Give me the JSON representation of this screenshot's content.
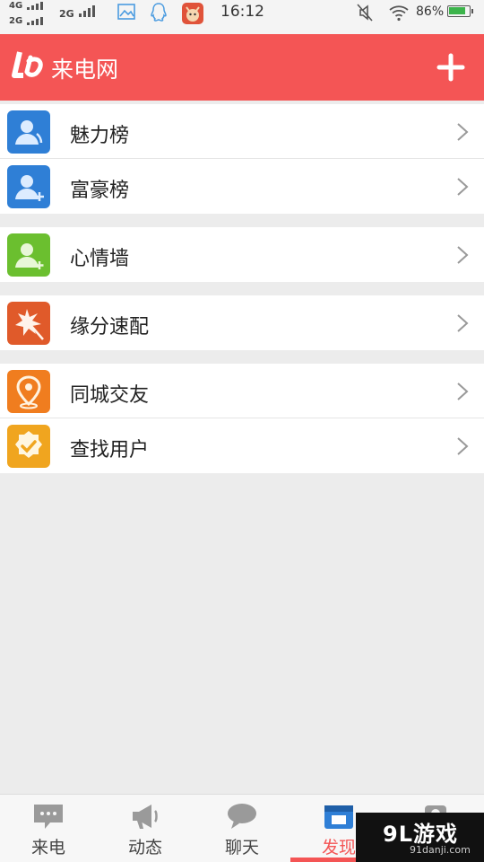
{
  "status_bar": {
    "network_top": "4G",
    "network_bottom": "2G",
    "network_secondary": "2G",
    "time": "16:12",
    "battery_percent": "86%",
    "battery_level": 0.86,
    "icons": [
      "gallery-icon",
      "qq-icon",
      "cat-app-icon",
      "mute-icon",
      "wifi-icon",
      "battery-icon"
    ]
  },
  "header": {
    "title": "来电网",
    "logo_icon": "laidian-logo-icon",
    "add_icon": "plus-icon",
    "color": "#f45555"
  },
  "menu": {
    "groups": [
      {
        "items": [
          {
            "label": "魅力榜",
            "icon": "charm-ranking-icon",
            "color": "#2f7fd6"
          },
          {
            "label": "富豪榜",
            "icon": "rich-ranking-icon",
            "color": "#2f7fd6"
          }
        ]
      },
      {
        "items": [
          {
            "label": "心情墙",
            "icon": "mood-wall-icon",
            "color": "#6bbf2f"
          }
        ]
      },
      {
        "items": [
          {
            "label": "缘分速配",
            "icon": "fate-match-icon",
            "color": "#e05a2a"
          }
        ]
      },
      {
        "items": [
          {
            "label": "同城交友",
            "icon": "location-pin-icon",
            "color": "#f07d1f"
          },
          {
            "label": "查找用户",
            "icon": "badge-check-icon",
            "color": "#f0a51f"
          }
        ]
      }
    ]
  },
  "tabs": [
    {
      "label": "来电",
      "icon": "message-box-icon"
    },
    {
      "label": "动态",
      "icon": "megaphone-icon"
    },
    {
      "label": "聊天",
      "icon": "chat-bubble-icon"
    },
    {
      "label": "发现",
      "icon": "discover-icon",
      "active": true
    },
    {
      "label": "",
      "icon": "profile-icon"
    }
  ],
  "watermark": {
    "main": "9L游戏",
    "sub": "91danji.com"
  }
}
